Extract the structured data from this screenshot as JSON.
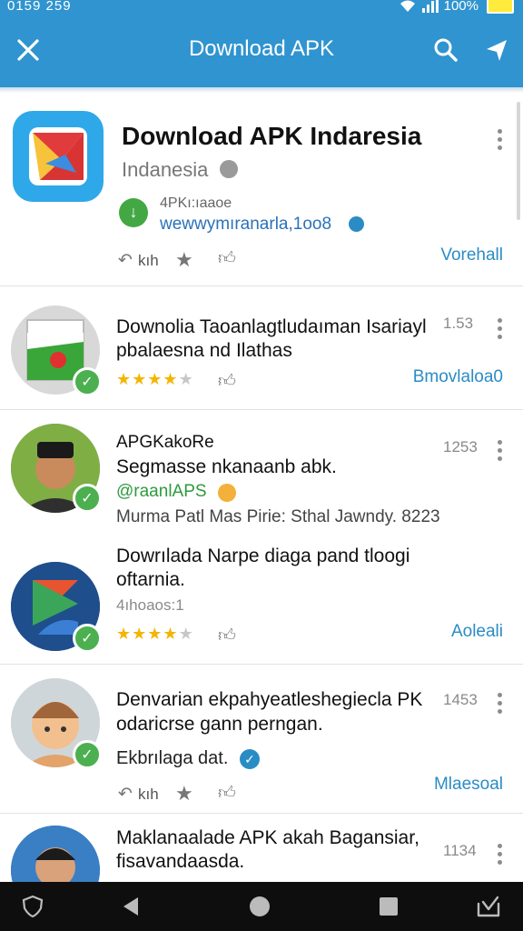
{
  "status": {
    "time": "0159 259",
    "battery": "100%"
  },
  "appbar": {
    "title": "Download APK"
  },
  "featured": {
    "title": "Download APK Indaresia",
    "subtitle": "Indanesia",
    "apk_label": "4PKı:ıaaoe",
    "url": "wewwymıranarla,1oo8",
    "meta_left": "kıh",
    "action": "Vorehall"
  },
  "items": [
    {
      "title_line1": "Downolia Taoanlagtludaıman Isariayl",
      "title_line2": "pbalaesna nd Ilathas",
      "time": "1.53",
      "rating": 4,
      "action": "Bmovlaloa0"
    },
    {
      "name": "APGKakoRe",
      "title_line1": "Segmasse nkanaanb abk.",
      "handle": "@raanlAPS",
      "time": "1253",
      "desc": "Murma Patl Mas Pirie: Sthal Jawndy. 8223"
    },
    {
      "title_line1": "Dowrılada Narpe diaga pand tloogi",
      "title_line2": "oftarnia.",
      "meta": "4ıhoaos:1",
      "rating": 4,
      "action": "Aoleali"
    },
    {
      "title_line1": "Denvarian ekpahyeatleshegiecla PK",
      "title_line2": "odaricrse gann perngan.",
      "meta": "Ekbrılaga dat.",
      "time": "1453",
      "meta_left": "kıh",
      "action": "Mlaesoal"
    },
    {
      "title_line1": "Maklanaalade APK akah Bagansiar,",
      "title_line2": "fisavandaasda.",
      "time": "1134"
    }
  ],
  "colors": {
    "appbar": "#2f94cf",
    "link": "#2a8cc5",
    "star": "#f5b400",
    "verified": "#4caf50"
  }
}
